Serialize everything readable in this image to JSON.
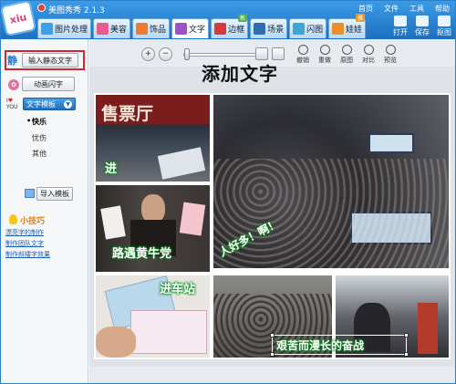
{
  "app": {
    "title": "美图秀秀 2.1.3",
    "logo_text": "xiu"
  },
  "top_menu": [
    "首页",
    "文件",
    "工具",
    "帮助"
  ],
  "tabs": [
    {
      "label": "图片处理",
      "icon": "image-icon",
      "color": "#3aa0e8"
    },
    {
      "label": "美容",
      "icon": "face-icon",
      "color": "#e85b8e"
    },
    {
      "label": "饰品",
      "icon": "heart-icon",
      "color": "#f07a2f"
    },
    {
      "label": "文字",
      "icon": "text-icon",
      "color": "#9a55c9"
    },
    {
      "label": "边框",
      "icon": "frame-icon",
      "color": "#d63a3a",
      "badge": "新"
    },
    {
      "label": "场景",
      "icon": "scene-icon",
      "color": "#2f6fb0"
    },
    {
      "label": "闪图",
      "icon": "flash-icon",
      "color": "#39a7d8"
    },
    {
      "label": "娃娃",
      "icon": "doll-icon",
      "color": "#e9902a",
      "badge": "推"
    }
  ],
  "toolbar": {
    "open": "打开",
    "save": "保存",
    "capture": "抠图"
  },
  "sidebar": {
    "static_icon": "静",
    "static_text_button": "输入静态文字",
    "dynamic_text_button": "动画闪字",
    "love_top": "I",
    "love_bottom": "YOU",
    "template_button": "文字模板",
    "moods": [
      "快乐",
      "忧伤",
      "其他"
    ],
    "import_button": "导入模板",
    "tips_title": "小技巧",
    "tips": [
      "漂亮字的制作",
      "制作团队文字",
      "制作斜矮字效果"
    ]
  },
  "editor_toolbar": {
    "undo": "撤销",
    "redo": "重做",
    "original": "原图",
    "compare": "对比",
    "preview": "预览"
  },
  "headline": "添加文字",
  "captions": {
    "p1_sign": "售票厅",
    "p1": "进",
    "p3": "路遇黄牛党",
    "p4": "人好多！啊！",
    "p5": "进车站",
    "p7": "艰苦而漫长的奋战"
  },
  "colors": {
    "accent": "#1d6fc0",
    "caption_outline": "#0a8a1f",
    "highlight": "#d0262d"
  }
}
